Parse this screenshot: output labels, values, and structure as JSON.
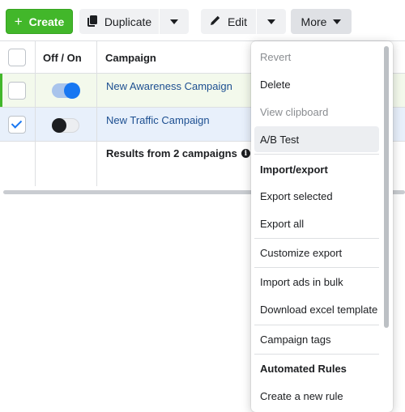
{
  "toolbar": {
    "create_label": "Create",
    "duplicate_label": "Duplicate",
    "edit_label": "Edit",
    "more_label": "More"
  },
  "table": {
    "headers": {
      "toggle": "Off / On",
      "campaign": "Campaign"
    },
    "rows": [
      {
        "name": "New Awareness Campaign",
        "checked": false,
        "on": true
      },
      {
        "name": "New Traffic Campaign",
        "checked": true,
        "on": false
      }
    ],
    "results_text": "Results from 2 campaigns"
  },
  "menu": {
    "items": [
      {
        "label": "Revert",
        "state": "disabled"
      },
      {
        "label": "Delete",
        "state": "normal"
      },
      {
        "label": "View clipboard",
        "state": "disabled"
      },
      {
        "label": "A/B Test",
        "state": "hover"
      },
      {
        "label": "Import/export",
        "state": "section"
      },
      {
        "label": "Export selected",
        "state": "normal"
      },
      {
        "label": "Export all",
        "state": "normal"
      },
      {
        "label": "Customize export",
        "state": "normal"
      },
      {
        "label": "Import ads in bulk",
        "state": "normal"
      },
      {
        "label": "Download excel template",
        "state": "normal"
      },
      {
        "label": "Campaign tags",
        "state": "normal"
      },
      {
        "label": "Automated Rules",
        "state": "section"
      },
      {
        "label": "Create a new rule",
        "state": "normal"
      }
    ]
  },
  "colors": {
    "create_green": "#42b72a",
    "link_blue": "#1d4f91",
    "toggle_on": "#1877f2"
  }
}
